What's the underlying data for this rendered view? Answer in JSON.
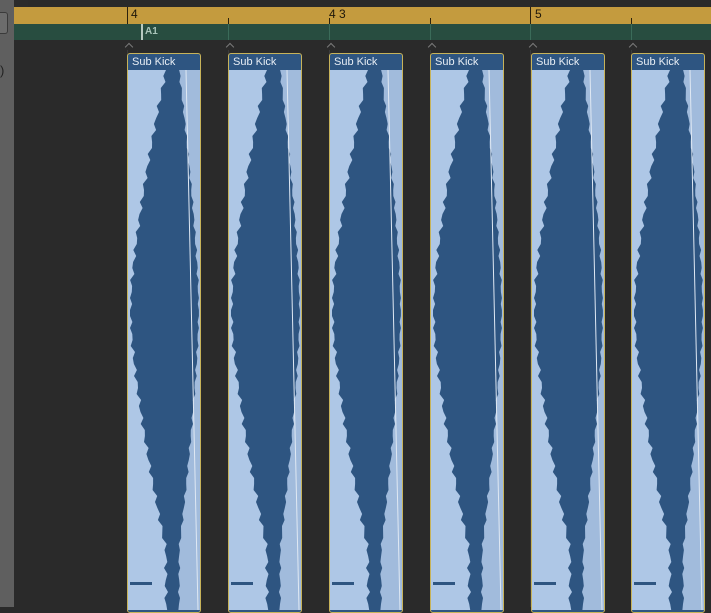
{
  "ruler": {
    "labels": [
      "4",
      "4 3",
      "5"
    ]
  },
  "marker": {
    "label": "A1"
  },
  "regions": [
    {
      "name": "Sub Kick"
    },
    {
      "name": "Sub Kick"
    },
    {
      "name": "Sub Kick"
    },
    {
      "name": "Sub Kick"
    },
    {
      "name": "Sub Kick"
    },
    {
      "name": "Sub Kick"
    }
  ],
  "colors": {
    "ruler": "#c49b3e",
    "marker_lane": "#284d40",
    "region_bg": "#2e5581",
    "waveform": "#aec7e6",
    "region_border": "#c7b35a"
  }
}
